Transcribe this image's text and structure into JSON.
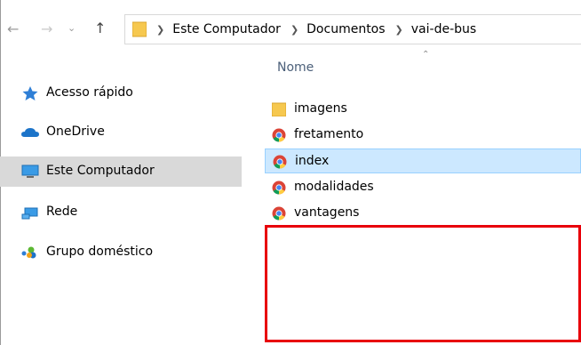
{
  "address_bar": {
    "breadcrumbs": [
      "Este Computador",
      "Documentos",
      "vai-de-bus"
    ]
  },
  "sidebar": {
    "items": [
      {
        "label": "Acesso rápido",
        "icon": "star-icon"
      },
      {
        "label": "OneDrive",
        "icon": "cloud-icon"
      },
      {
        "label": "Este Computador",
        "icon": "computer-icon",
        "selected": true
      },
      {
        "label": "Rede",
        "icon": "network-icon"
      },
      {
        "label": "Grupo doméstico",
        "icon": "homegroup-icon"
      }
    ]
  },
  "content": {
    "column_header": "Nome",
    "files": [
      {
        "name": "imagens",
        "icon": "folder-icon"
      },
      {
        "name": "fretamento",
        "icon": "chrome-icon"
      },
      {
        "name": "index",
        "icon": "chrome-icon",
        "selected": true
      },
      {
        "name": "modalidades",
        "icon": "chrome-icon"
      },
      {
        "name": "vantagens",
        "icon": "chrome-icon"
      }
    ]
  },
  "colors": {
    "selection_bg": "#cce8ff",
    "sidebar_selected_bg": "#d9d9d9",
    "highlight_box": "#e8000a"
  }
}
